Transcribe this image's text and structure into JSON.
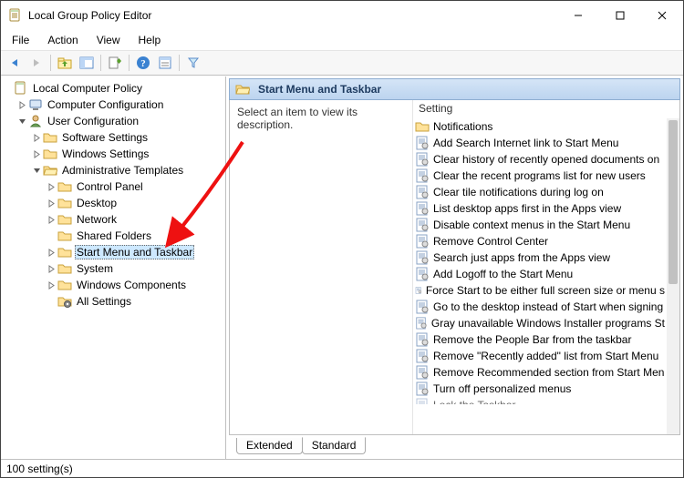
{
  "window": {
    "title": "Local Group Policy Editor"
  },
  "menu": {
    "file": "File",
    "action": "Action",
    "view": "View",
    "help": "Help"
  },
  "toolbar_icons": [
    "back",
    "forward",
    "up",
    "show-hide-tree",
    "export-list",
    "refresh",
    "help",
    "properties",
    "filter"
  ],
  "tree": {
    "root": "Local Computer Policy",
    "computer": "Computer Configuration",
    "user": "User Configuration",
    "software": "Software Settings",
    "windows": "Windows Settings",
    "admin": "Administrative Templates",
    "admin_children": [
      {
        "label": "Control Panel",
        "expandable": true
      },
      {
        "label": "Desktop",
        "expandable": true
      },
      {
        "label": "Network",
        "expandable": true
      },
      {
        "label": "Shared Folders",
        "expandable": false
      },
      {
        "label": "Start Menu and Taskbar",
        "expandable": true,
        "selected": true
      },
      {
        "label": "System",
        "expandable": true
      },
      {
        "label": "Windows Components",
        "expandable": true
      },
      {
        "label": "All Settings",
        "expandable": false,
        "gear": true
      }
    ]
  },
  "details": {
    "header": "Start Menu and Taskbar",
    "description": "Select an item to view its description.",
    "column": "Setting",
    "settings": [
      {
        "type": "folder",
        "label": "Notifications"
      },
      {
        "type": "policy",
        "label": "Add Search Internet link to Start Menu"
      },
      {
        "type": "policy",
        "label": "Clear history of recently opened documents on"
      },
      {
        "type": "policy",
        "label": "Clear the recent programs list for new users"
      },
      {
        "type": "policy",
        "label": "Clear tile notifications during log on"
      },
      {
        "type": "policy",
        "label": "List desktop apps first in the Apps view"
      },
      {
        "type": "policy",
        "label": "Disable context menus in the Start Menu"
      },
      {
        "type": "policy",
        "label": "Remove Control Center"
      },
      {
        "type": "policy",
        "label": "Search just apps from the Apps view"
      },
      {
        "type": "policy",
        "label": "Add Logoff to the Start Menu"
      },
      {
        "type": "policy",
        "label": "Force Start to be either full screen size or menu s"
      },
      {
        "type": "policy",
        "label": "Go to the desktop instead of Start when signing"
      },
      {
        "type": "policy",
        "label": "Gray unavailable Windows Installer programs St"
      },
      {
        "type": "policy",
        "label": "Remove the People Bar from the taskbar"
      },
      {
        "type": "policy",
        "label": "Remove \"Recently added\" list from Start Menu"
      },
      {
        "type": "policy",
        "label": "Remove Recommended section from Start Men"
      },
      {
        "type": "policy",
        "label": "Turn off personalized menus"
      },
      {
        "type": "policy",
        "label": "Lock the Taskbar",
        "cut": true
      }
    ]
  },
  "tabs": {
    "extended": "Extended",
    "standard": "Standard"
  },
  "status": "100 setting(s)"
}
